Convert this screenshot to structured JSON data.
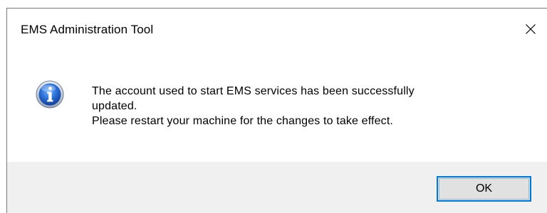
{
  "dialog": {
    "title": "EMS Administration Tool",
    "close_icon": "close-icon",
    "icon": "information-icon",
    "message_lines": [
      "The account used to start EMS services has been successfully",
      "updated.",
      "Please restart your machine for the changes to take effect."
    ],
    "ok_label": "OK",
    "colors": {
      "footer_bg": "#f0f0f0",
      "button_focus_border": "#0078d7",
      "button_bg": "#e1e1e1",
      "icon_blue": "#1e63c4"
    }
  }
}
